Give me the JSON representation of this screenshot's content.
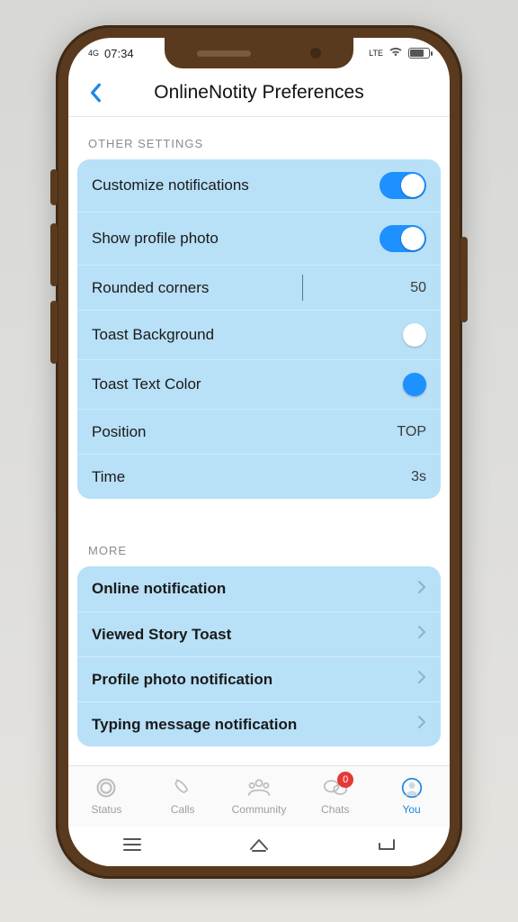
{
  "status": {
    "time": "07:34",
    "net": "4G"
  },
  "header": {
    "title": "OnlineNotity Preferences"
  },
  "sections": {
    "other_label": "OTHER SETTINGS",
    "more_label": "MORE"
  },
  "other": {
    "customize": {
      "label": "Customize notifications",
      "on": true
    },
    "show_photo": {
      "label": "Show profile photo",
      "on": true
    },
    "rounded": {
      "label": "Rounded corners",
      "value": "50"
    },
    "toast_bg": {
      "label": "Toast Background",
      "color": "#ffffff"
    },
    "toast_txt": {
      "label": "Toast Text Color",
      "color": "#1e90ff"
    },
    "position": {
      "label": "Position",
      "value": "TOP"
    },
    "time": {
      "label": "Time",
      "value": "3s"
    }
  },
  "more": {
    "items": [
      {
        "label": "Online notification"
      },
      {
        "label": "Viewed Story Toast"
      },
      {
        "label": "Profile photo notification"
      },
      {
        "label": "Typing message notification"
      }
    ]
  },
  "nav": {
    "tabs": [
      {
        "label": "Status"
      },
      {
        "label": "Calls"
      },
      {
        "label": "Community"
      },
      {
        "label": "Chats",
        "badge": "0"
      },
      {
        "label": "You",
        "active": true
      }
    ]
  }
}
